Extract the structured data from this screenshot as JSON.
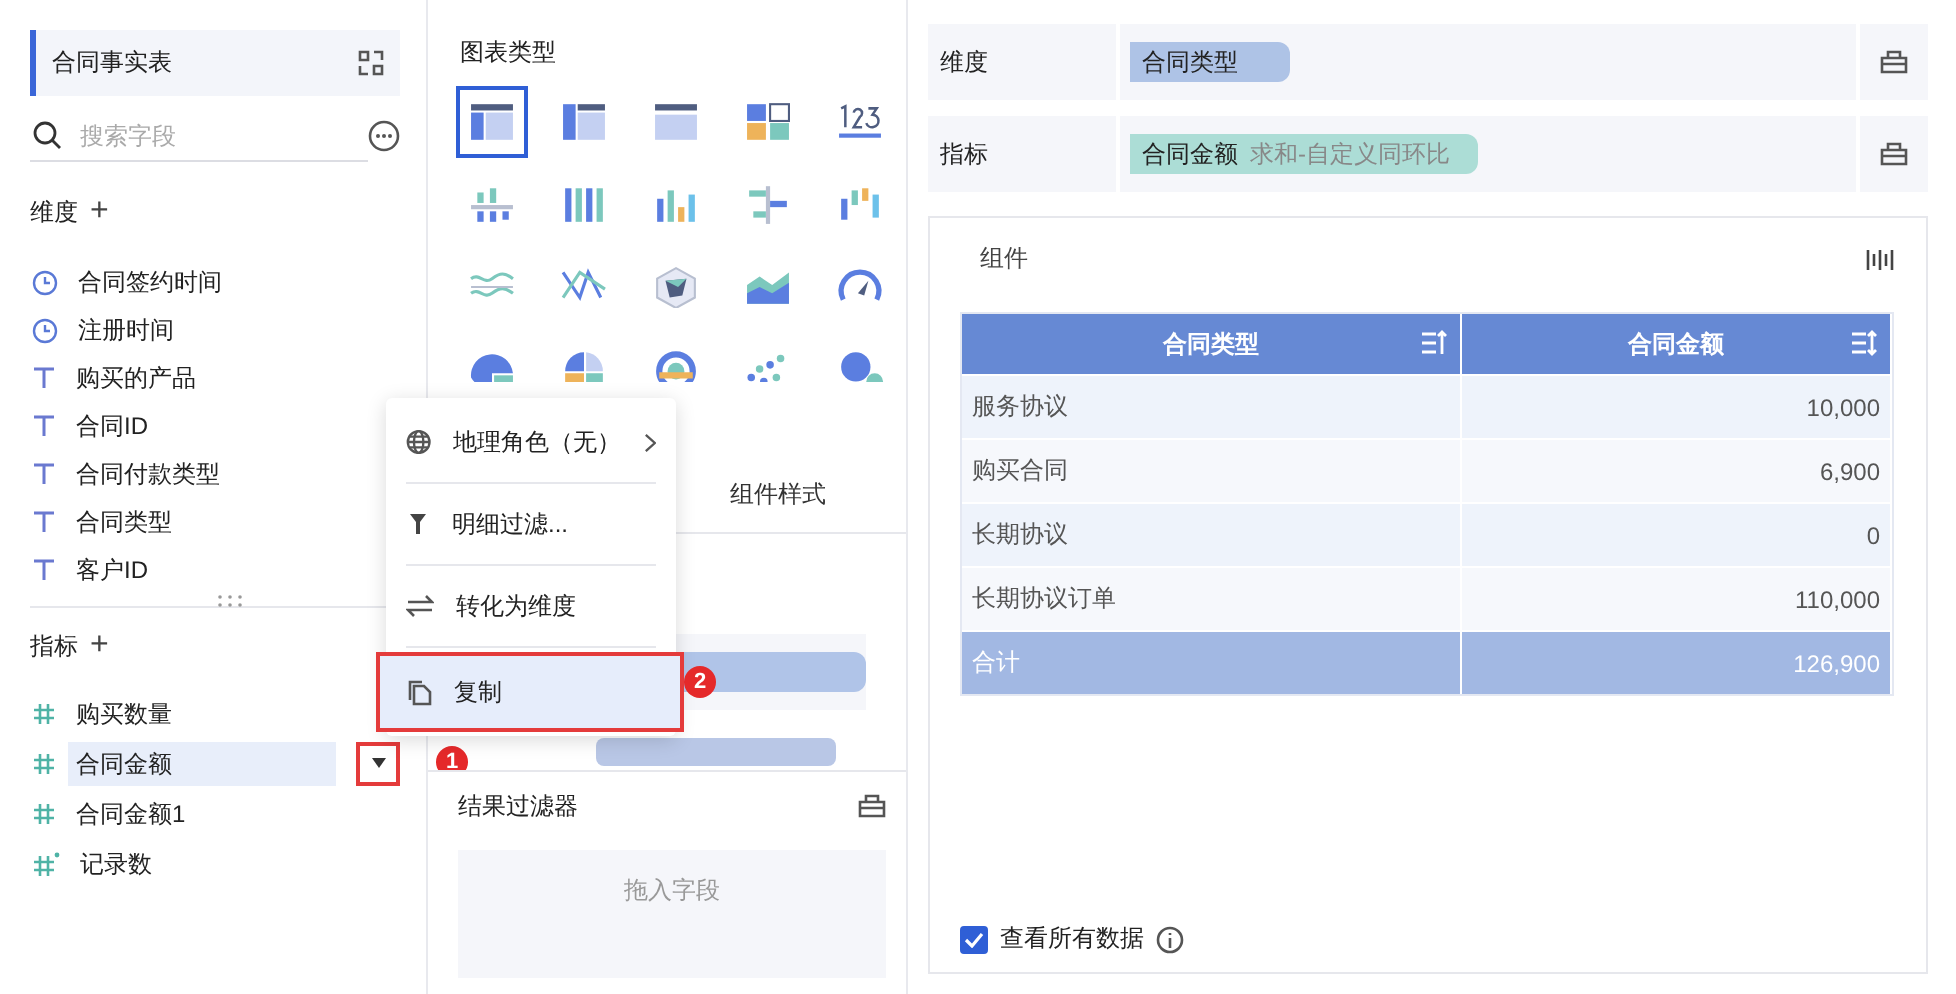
{
  "left_panel": {
    "dataset": "合同事实表",
    "search": {
      "placeholder": "搜索字段"
    },
    "dimensions": {
      "title": "维度",
      "add": "+",
      "fields": [
        {
          "kind": "time",
          "name": "合同签约时间"
        },
        {
          "kind": "time",
          "name": "注册时间"
        },
        {
          "kind": "text",
          "name": "购买的产品"
        },
        {
          "kind": "text",
          "name": "合同ID"
        },
        {
          "kind": "text",
          "name": "合同付款类型"
        },
        {
          "kind": "text",
          "name": "合同类型"
        },
        {
          "kind": "text",
          "name": "客户ID"
        }
      ]
    },
    "measures": {
      "title": "指标",
      "add": "+",
      "fields": [
        {
          "kind": "number",
          "name": "购买数量",
          "selected": false
        },
        {
          "kind": "number",
          "name": "合同金额",
          "selected": true
        },
        {
          "kind": "number",
          "name": "合同金额1",
          "selected": false
        },
        {
          "kind": "count",
          "name": "记录数",
          "selected": false
        }
      ]
    }
  },
  "middle_panel": {
    "chart_types_title": "图表类型",
    "chart_types": [
      {
        "selected": true
      },
      {
        "selected": false
      },
      {
        "selected": false
      },
      {
        "selected": false
      },
      {
        "selected": false
      },
      {
        "selected": false
      },
      {
        "selected": false
      },
      {
        "selected": false
      },
      {
        "selected": false
      },
      {
        "selected": false
      },
      {
        "selected": false
      },
      {
        "selected": false
      },
      {
        "selected": false
      },
      {
        "selected": false
      },
      {
        "selected": false
      },
      {
        "selected": false
      },
      {
        "selected": false
      },
      {
        "selected": false
      },
      {
        "selected": false
      },
      {
        "selected": false
      }
    ],
    "tabs": [
      {
        "label": "组件样式",
        "selected": false
      }
    ],
    "result_filter": {
      "title": "结果过滤器",
      "placeholder": "拖入字段"
    }
  },
  "context_menu": {
    "items": [
      {
        "kind": "globe",
        "label": "地理角色（无）",
        "submenu": true,
        "highlighted": false
      },
      {
        "kind": "filter",
        "label": "明细过滤...",
        "submenu": false,
        "highlighted": false
      },
      {
        "kind": "swap",
        "label": "转化为维度",
        "submenu": false,
        "highlighted": false
      },
      {
        "kind": "copy",
        "label": "复制",
        "submenu": false,
        "highlighted": true
      }
    ]
  },
  "annotations": [
    {
      "label": "1"
    },
    {
      "label": "2"
    }
  ],
  "right_panel": {
    "dimension_row": {
      "label": "维度",
      "chip": "合同类型"
    },
    "measure_row": {
      "label": "指标",
      "chip": "合同金额",
      "chip_note": "求和-自定义同环比"
    },
    "component": {
      "title": "组件",
      "table": {
        "columns": [
          "合同类型",
          "合同金额"
        ],
        "rows": [
          [
            "服务协议",
            "10,000"
          ],
          [
            "购买合同",
            "6,900"
          ],
          [
            "长期协议",
            "0"
          ],
          [
            "长期协议订单",
            "110,000"
          ]
        ],
        "total": [
          "合计",
          "126,900"
        ]
      },
      "show_all": {
        "label": "查看所有数据",
        "checked": true
      }
    }
  }
}
